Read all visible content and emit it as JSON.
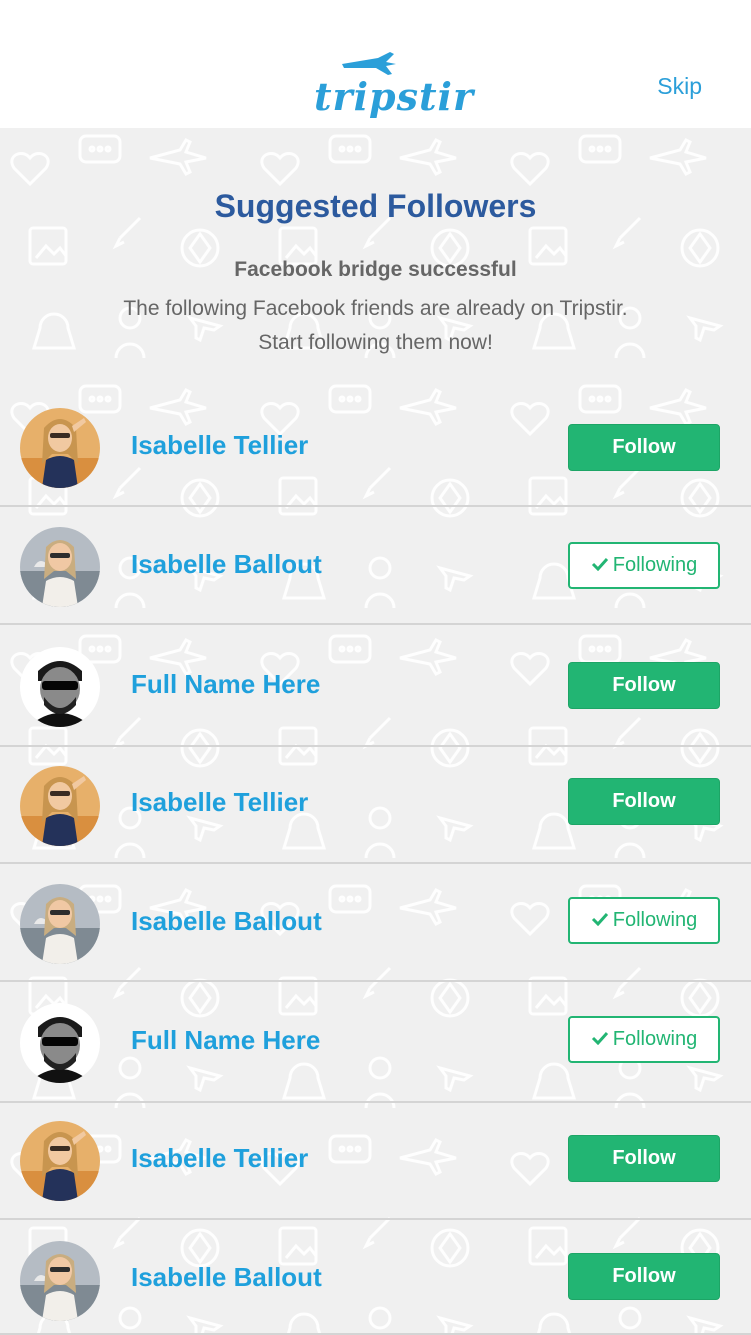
{
  "header": {
    "logo_text": "tripstir",
    "skip_label": "Skip"
  },
  "intro": {
    "title": "Suggested Followers",
    "subtitle_bold": "Facebook bridge successful",
    "line1": "The following Facebook friends are already on Tripstir.",
    "line2": "Start following them now!"
  },
  "colors": {
    "brand_blue": "#2b9fd9",
    "title_blue": "#2c5a9e",
    "name_blue": "#1fa0dc",
    "follow_green": "#22b573"
  },
  "followers": [
    {
      "name": "Isabelle Tellier",
      "button": "Follow",
      "state": "follow",
      "avatar": "avatar-photo-1"
    },
    {
      "name": "Isabelle Ballout",
      "button": "Following",
      "state": "following",
      "avatar": "avatar-photo-2"
    },
    {
      "name": "Full Name Here",
      "button": "Follow",
      "state": "follow",
      "avatar": "avatar-photo-3"
    },
    {
      "name": "Isabelle Tellier",
      "button": "Follow",
      "state": "follow",
      "avatar": "avatar-photo-1"
    },
    {
      "name": "Isabelle Ballout",
      "button": "Following",
      "state": "following",
      "avatar": "avatar-photo-2"
    },
    {
      "name": "Full Name Here",
      "button": "Following",
      "state": "following",
      "avatar": "avatar-photo-3"
    },
    {
      "name": "Isabelle Tellier",
      "button": "Follow",
      "state": "follow",
      "avatar": "avatar-photo-1"
    },
    {
      "name": "Isabelle Ballout",
      "button": "Follow",
      "state": "follow",
      "avatar": "avatar-photo-2"
    }
  ]
}
